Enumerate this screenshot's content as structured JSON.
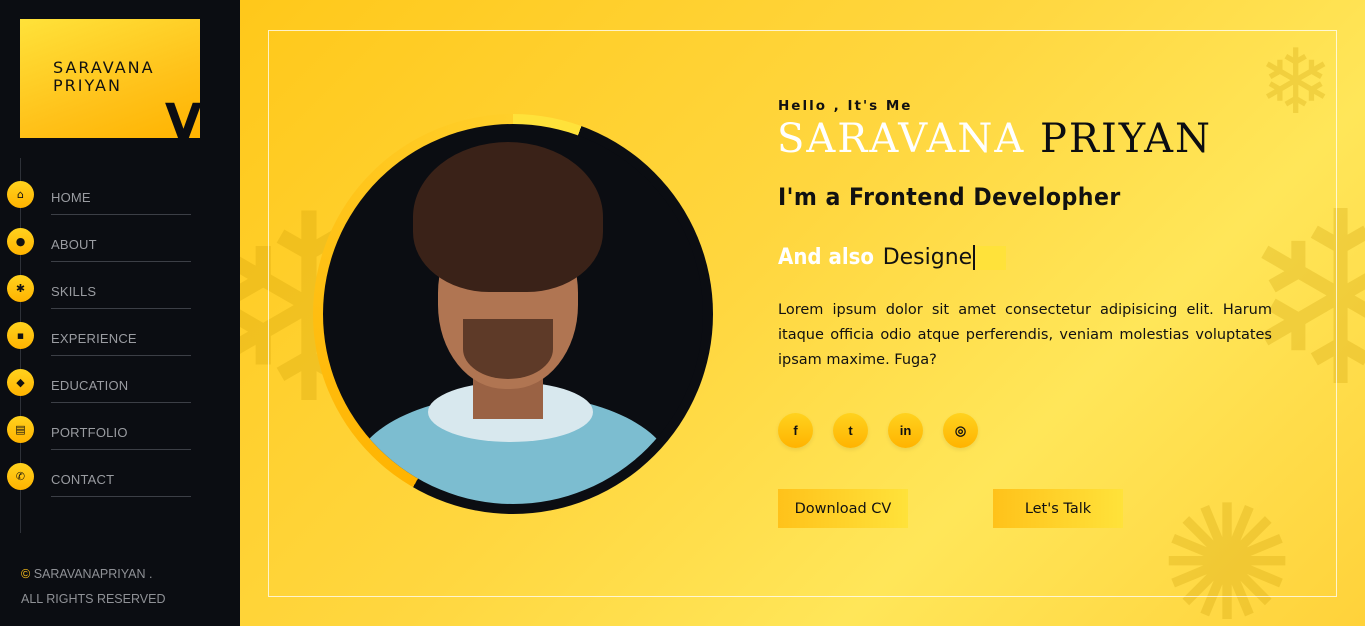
{
  "logo": {
    "line1": "SARAVANA",
    "line2": "PRIYAN",
    "mark": "V"
  },
  "nav": [
    {
      "label": "HOME",
      "icon": "home-icon",
      "glyph": "⌂"
    },
    {
      "label": "ABOUT",
      "icon": "user-icon",
      "glyph": "●"
    },
    {
      "label": "SKILLS",
      "icon": "gear-icon",
      "glyph": "✱"
    },
    {
      "label": "EXPERIENCE",
      "icon": "briefcase-icon",
      "glyph": "▪"
    },
    {
      "label": "EDUCATION",
      "icon": "graduation-cap-icon",
      "glyph": "◆"
    },
    {
      "label": "PORTFOLIO",
      "icon": "portfolio-icon",
      "glyph": "▤"
    },
    {
      "label": "CONTACT",
      "icon": "phone-icon",
      "glyph": "✆"
    }
  ],
  "footer": {
    "symbol": "©",
    "owner": "SARAVANAPRIYAN .",
    "rights": "ALL RIGHTS RESERVED"
  },
  "hero": {
    "greeting": "Hello , It's Me",
    "first_name": "SARAVANA",
    "last_name": "PRIYAN",
    "role": "I'm a Frontend Developher",
    "also_lead": "And also",
    "also_typed": "Designe",
    "description": "Lorem ipsum dolor sit amet consectetur adipisicing elit. Harum itaque officia odio atque perferendis, veniam molestias voluptates ipsam maxime. Fuga?"
  },
  "socials": [
    {
      "icon": "facebook-icon",
      "glyph": "f"
    },
    {
      "icon": "twitter-icon",
      "glyph": "t"
    },
    {
      "icon": "linkedin-icon",
      "glyph": "in"
    },
    {
      "icon": "instagram-icon",
      "glyph": "◎"
    }
  ],
  "buttons": {
    "download": "Download CV",
    "talk": "Let's Talk"
  },
  "colors": {
    "accent": "#ffc21a",
    "accent_light": "#ffe23a",
    "dark": "#0b0d12"
  }
}
